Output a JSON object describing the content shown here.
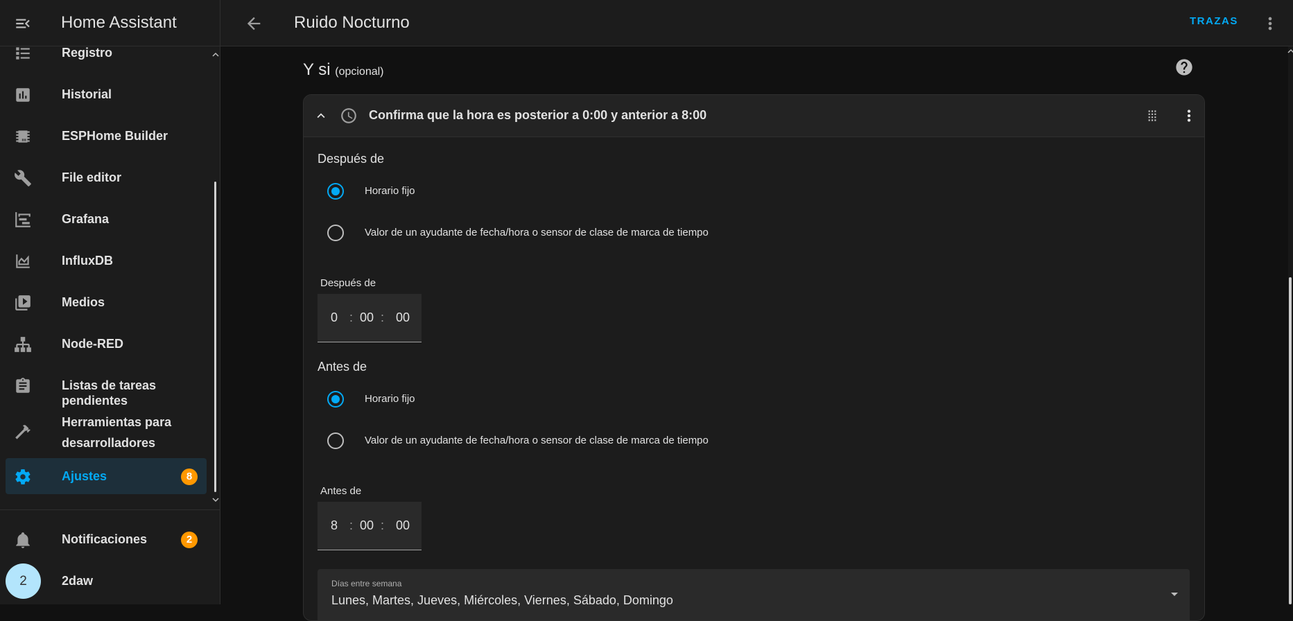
{
  "app": {
    "title": "Home Assistant",
    "accent_color": "#03a9f4",
    "badge_color": "#ff9800"
  },
  "sidebar": {
    "items": [
      {
        "label": "Registro",
        "icon": "list-icon"
      },
      {
        "label": "Historial",
        "icon": "chart-box-icon"
      },
      {
        "label": "ESPHome Builder",
        "icon": "chip-icon"
      },
      {
        "label": "File editor",
        "icon": "wrench-icon"
      },
      {
        "label": "Grafana",
        "icon": "chart-timeline-icon"
      },
      {
        "label": "InfluxDB",
        "icon": "chart-areaspline-icon"
      },
      {
        "label": "Medios",
        "icon": "play-box-multiple-icon"
      },
      {
        "label": "Node-RED",
        "icon": "sitemap-icon"
      },
      {
        "label": "Listas de tareas pendientes",
        "icon": "clipboard-list-icon"
      },
      {
        "label": "Herramientas para desarrolladores",
        "icon": "hammer-icon"
      },
      {
        "label": "Ajustes",
        "icon": "cog-icon",
        "badge": "8",
        "active": true
      }
    ],
    "notifications": {
      "label": "Notificaciones",
      "badge": "2",
      "icon": "bell-icon"
    },
    "user": {
      "name": "2daw",
      "avatar_initial": "2"
    }
  },
  "topbar": {
    "title": "Ruido Nocturno",
    "traces_button": "TRAZAS"
  },
  "section": {
    "title": "Y si",
    "optional_label": "(opcional)"
  },
  "condition_card": {
    "title": "Confirma que la hora es posterior a 0:00 y anterior a 8:00",
    "after": {
      "heading": "Después de",
      "options": [
        "Horario fijo",
        "Valor de un ayudante de fecha/hora o sensor de clase de marca de tiempo"
      ],
      "selected": 0,
      "time_label": "Después de",
      "hours": "0",
      "minutes": "00",
      "seconds": "00"
    },
    "before": {
      "heading": "Antes de",
      "options": [
        "Horario fijo",
        "Valor de un ayudante de fecha/hora o sensor de clase de marca de tiempo"
      ],
      "selected": 0,
      "time_label": "Antes de",
      "hours": "8",
      "minutes": "00",
      "seconds": "00"
    },
    "weekdays": {
      "label": "Días entre semana",
      "value": "Lunes, Martes, Jueves, Miércoles, Viernes, Sábado, Domingo"
    }
  }
}
